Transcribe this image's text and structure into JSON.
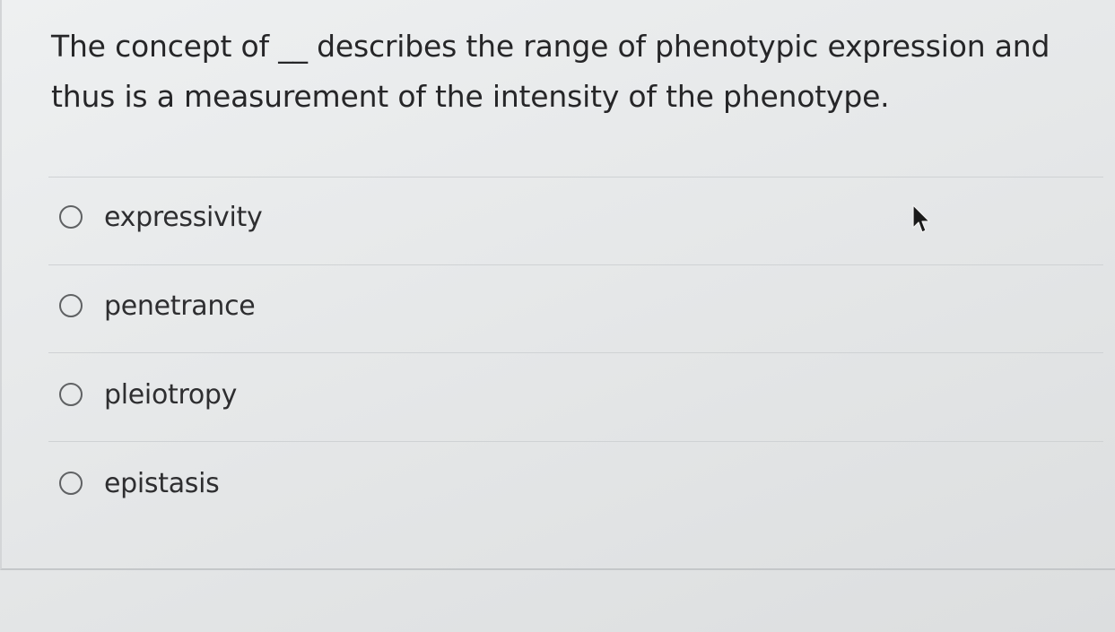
{
  "question": {
    "text": "The concept of __ describes the range of phenotypic expression and thus is a measurement of the intensity of the phenotype."
  },
  "options": [
    {
      "label": "expressivity",
      "selected": false
    },
    {
      "label": "penetrance",
      "selected": false
    },
    {
      "label": "pleiotropy",
      "selected": false
    },
    {
      "label": "epistasis",
      "selected": false
    }
  ],
  "cursor": {
    "icon": "arrow-pointer-icon"
  },
  "colors": {
    "background": "#e8eaeb",
    "text": "#262628",
    "divider": "#cfd2d4",
    "radio_border": "#5f6163"
  }
}
